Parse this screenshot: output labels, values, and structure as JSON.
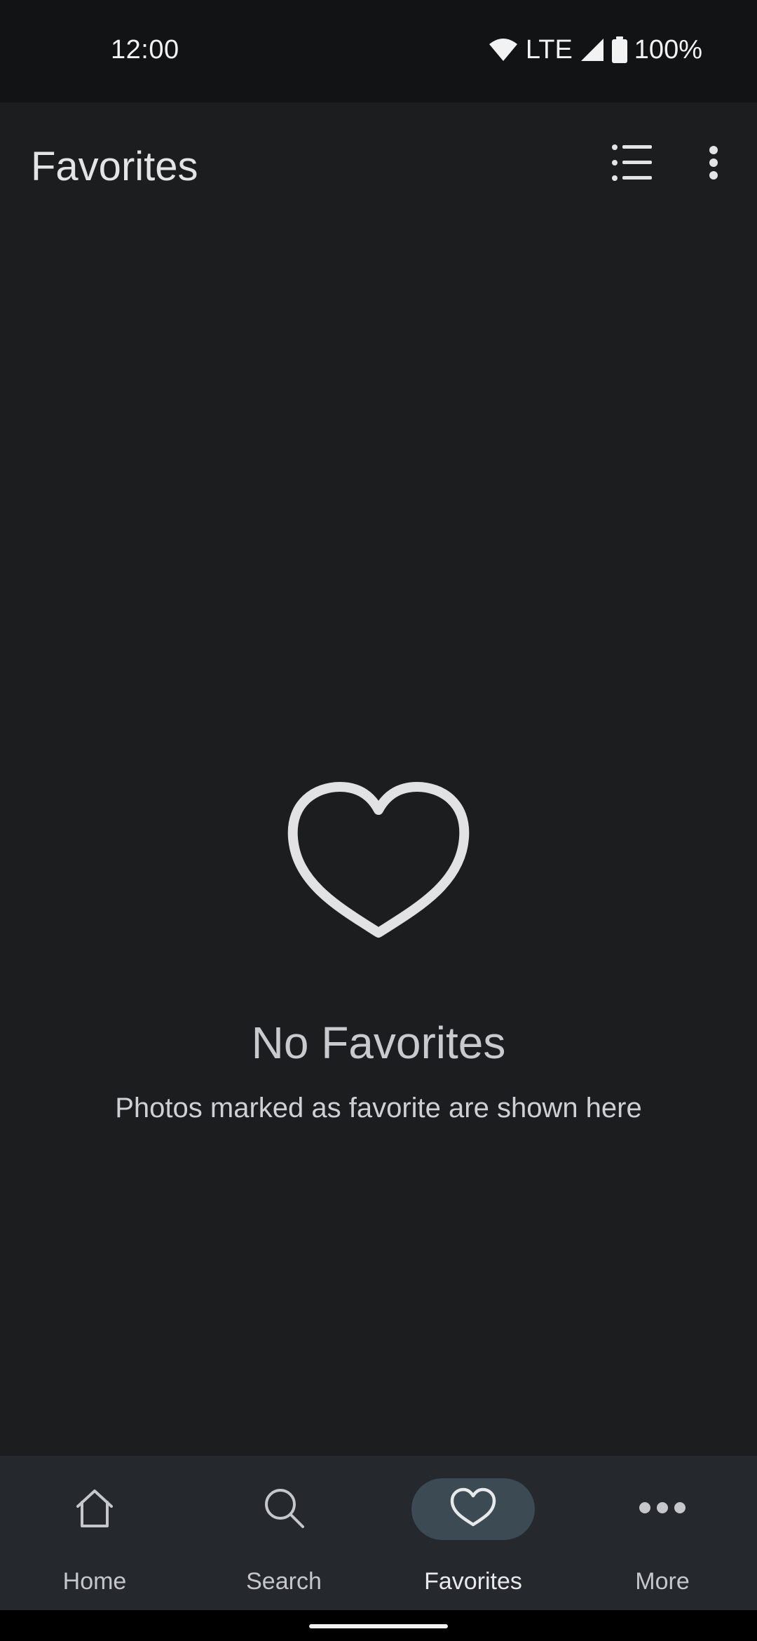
{
  "status_bar": {
    "time": "12:00",
    "network": "LTE",
    "battery": "100%",
    "icons": [
      "wifi-icon",
      "signal-icon",
      "battery-icon"
    ]
  },
  "app_bar": {
    "title": "Favorites",
    "actions": [
      "list-view-icon",
      "more-vert-icon"
    ]
  },
  "empty_state": {
    "icon": "heart-outline-icon",
    "title": "No Favorites",
    "subtitle": "Photos marked as favorite are shown here"
  },
  "bottom_nav": {
    "items": [
      {
        "label": "Home",
        "icon": "home-icon",
        "active": false
      },
      {
        "label": "Search",
        "icon": "search-icon",
        "active": false
      },
      {
        "label": "Favorites",
        "icon": "heart-icon",
        "active": true
      },
      {
        "label": "More",
        "icon": "more-horiz-icon",
        "active": false
      }
    ]
  },
  "colors": {
    "background": "#1c1d1f",
    "status_bar": "#121315",
    "bottom_nav": "#25282c",
    "active_pill": "#3b4a53",
    "text_primary": "#e4e4e6"
  }
}
